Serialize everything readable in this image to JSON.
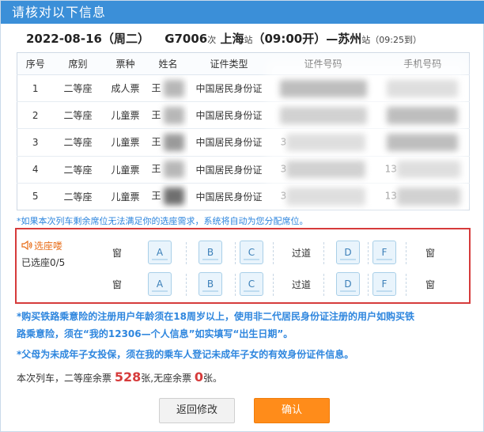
{
  "dialog": {
    "title": "请核对以下信息"
  },
  "trip": {
    "date": "2022-08-16（周二）",
    "train": "G7006",
    "train_suffix": "次",
    "from": "上海",
    "from_suffix": "站",
    "depart": "（09:00开）",
    "arrow": "—",
    "to": "苏州",
    "to_suffix": "站",
    "arrive": "（09:25到）"
  },
  "table": {
    "headers": [
      "序号",
      "席别",
      "票种",
      "姓名",
      "证件类型",
      "证件号码",
      "手机号码"
    ],
    "rows": [
      {
        "no": "1",
        "seat": "二等座",
        "ticket": "成人票",
        "name": "王",
        "id_type": "中国居民身份证",
        "id_no": "",
        "phone": ""
      },
      {
        "no": "2",
        "seat": "二等座",
        "ticket": "儿童票",
        "name": "王",
        "id_type": "中国居民身份证",
        "id_no": "",
        "phone": ""
      },
      {
        "no": "3",
        "seat": "二等座",
        "ticket": "儿童票",
        "name": "王",
        "id_type": "中国居民身份证",
        "id_no": "3",
        "phone": ""
      },
      {
        "no": "4",
        "seat": "二等座",
        "ticket": "儿童票",
        "name": "王",
        "id_type": "中国居民身份证",
        "id_no": "3",
        "phone": "13"
      },
      {
        "no": "5",
        "seat": "二等座",
        "ticket": "儿童票",
        "name": "王",
        "id_type": "中国居民身份证",
        "id_no": "3",
        "phone": "13"
      }
    ]
  },
  "notice": "*如果本次列车剩余席位无法满足你的选座需求，系统将自动为您分配席位。",
  "seat_select": {
    "label": "选座喽",
    "count": "已选座0/5",
    "window": "窗",
    "aisle": "过道",
    "seats": [
      "A",
      "B",
      "C",
      "D",
      "F"
    ]
  },
  "warnings": {
    "w1": "*购买铁路乘意险的注册用户年龄须在18周岁以上，使用非二代居民身份证注册的用户如购买铁",
    "w2": "路乘意险，须在“我的12306—个人信息”如实填写“出生日期”。",
    "w3": "*父母为未成年子女投保，须在我的乘车人登记未成年子女的有效身份证件信息。"
  },
  "remain": {
    "prefix": "本次列车，二等座余票",
    "second_count": "528",
    "middle": "张,无座余票",
    "noseat_count": "0",
    "suffix": "张。"
  },
  "buttons": {
    "back": "返回修改",
    "confirm": "确认"
  },
  "colors": {
    "title_bar": "#3b8fd8",
    "accent_blue": "#2e86de",
    "highlight_red": "#d63b3b",
    "orange": "#ff8c1a"
  }
}
